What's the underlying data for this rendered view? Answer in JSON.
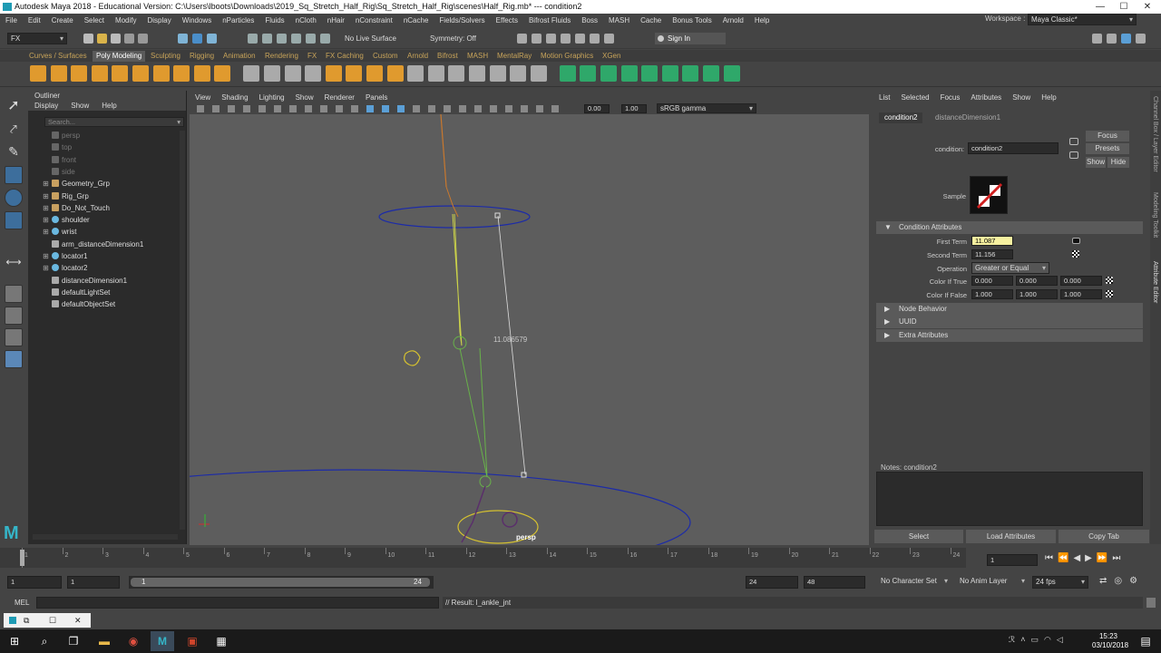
{
  "window": {
    "title": "Autodesk Maya 2018 - Educational Version: C:\\Users\\lboots\\Downloads\\2019_Sq_Stretch_Half_Rig\\Sq_Stretch_Half_Rig\\scenes\\Half_Rig.mb*   ---   condition2",
    "minimize": "—",
    "maximize": "☐",
    "close": "✕"
  },
  "menus": [
    "File",
    "Edit",
    "Create",
    "Select",
    "Modify",
    "Display",
    "Windows",
    "nParticles",
    "Fluids",
    "nCloth",
    "nHair",
    "nConstraint",
    "nCache",
    "Fields/Solvers",
    "Effects",
    "Bifrost Fluids",
    "Boss",
    "MASH",
    "Cache",
    "Bonus Tools",
    "Arnold",
    "Help"
  ],
  "workspace": {
    "label": "Workspace :",
    "value": "Maya Classic*"
  },
  "status": {
    "menuset": "FX",
    "live_surface": "No Live Surface",
    "symmetry": "Symmetry: Off",
    "sign_in": "Sign In"
  },
  "shelf_tabs": [
    "Curves / Surfaces",
    "Poly Modeling",
    "Sculpting",
    "Rigging",
    "Animation",
    "Rendering",
    "FX",
    "FX Caching",
    "Custom",
    "Arnold",
    "Bifrost",
    "MASH",
    "MentalRay",
    "Motion Graphics",
    "XGen"
  ],
  "shelf_active": "Poly Modeling",
  "outliner": {
    "title": "Outliner",
    "menus": [
      "Display",
      "Show",
      "Help"
    ],
    "search_placeholder": "Search...",
    "items": [
      {
        "label": "persp",
        "dim": true,
        "expand": false,
        "icon": "camera-icon"
      },
      {
        "label": "top",
        "dim": true,
        "expand": false,
        "icon": "camera-icon"
      },
      {
        "label": "front",
        "dim": true,
        "expand": false,
        "icon": "camera-icon"
      },
      {
        "label": "side",
        "dim": true,
        "expand": false,
        "icon": "camera-icon"
      },
      {
        "label": "Geometry_Grp",
        "dim": false,
        "expand": true,
        "icon": "group-icon"
      },
      {
        "label": "Rig_Grp",
        "dim": false,
        "expand": true,
        "icon": "group-icon"
      },
      {
        "label": "Do_Not_Touch",
        "dim": false,
        "expand": true,
        "icon": "group-icon"
      },
      {
        "label": "shoulder",
        "dim": false,
        "expand": true,
        "icon": "joint-icon"
      },
      {
        "label": "wrist",
        "dim": false,
        "expand": true,
        "icon": "joint-icon"
      },
      {
        "label": "arm_distanceDimension1",
        "dim": false,
        "expand": false,
        "icon": "dimension-icon"
      },
      {
        "label": "locator1",
        "dim": false,
        "expand": true,
        "icon": "locator-icon"
      },
      {
        "label": "locator2",
        "dim": false,
        "expand": true,
        "icon": "locator-icon"
      },
      {
        "label": "distanceDimension1",
        "dim": false,
        "expand": false,
        "icon": "dimension-icon"
      },
      {
        "label": "defaultLightSet",
        "dim": false,
        "expand": false,
        "icon": "set-icon"
      },
      {
        "label": "defaultObjectSet",
        "dim": false,
        "expand": false,
        "icon": "set-icon"
      }
    ]
  },
  "viewport": {
    "menus": [
      "View",
      "Shading",
      "Lighting",
      "Show",
      "Renderer",
      "Panels"
    ],
    "exposure": "0.00",
    "gamma": "1.00",
    "colorspace": "sRGB gamma",
    "distance_label": "11.086579",
    "camera": "persp"
  },
  "ae": {
    "menus": [
      "List",
      "Selected",
      "Focus",
      "Attributes",
      "Show",
      "Help"
    ],
    "tabs": [
      "condition2",
      "distanceDimension1"
    ],
    "node_label": "condition:",
    "node_value": "condition2",
    "focus": "Focus",
    "presets": "Presets",
    "show": "Show",
    "hide": "Hide",
    "sample": "Sample",
    "section_condition": "Condition Attributes",
    "first_term_label": "First Term",
    "first_term": "11.087",
    "second_term_label": "Second Term",
    "second_term": "11.156",
    "operation_label": "Operation",
    "operation": "Greater or Equal",
    "color_true_label": "Color If True",
    "color_true": [
      "0.000",
      "0.000",
      "0.000"
    ],
    "color_false_label": "Color If False",
    "color_false": [
      "1.000",
      "1.000",
      "1.000"
    ],
    "sections": [
      "Node Behavior",
      "UUID",
      "Extra Attributes"
    ],
    "notes": "Notes:  condition2",
    "btn_select": "Select",
    "btn_load": "Load Attributes",
    "btn_copy": "Copy Tab"
  },
  "side_tabs": [
    "Channel Box / Layer Editor",
    "Modeling Toolkit",
    "Attribute Editor"
  ],
  "timeline": {
    "ticks": [
      "1",
      "2",
      "3",
      "4",
      "5",
      "6",
      "7",
      "8",
      "9",
      "10",
      "11",
      "12",
      "13",
      "14",
      "15",
      "16",
      "17",
      "18",
      "19",
      "20",
      "21",
      "22",
      "23",
      "24"
    ],
    "current": "1"
  },
  "range": {
    "start": "1",
    "anim_start": "1",
    "slider_start": "1",
    "slider_end": "24",
    "end": "24",
    "anim_end": "48",
    "character_set": "No Character Set",
    "anim_layer": "No Anim Layer",
    "fps": "24 fps"
  },
  "cmd": {
    "mel": "MEL",
    "result": "// Result: l_ankle_jnt"
  },
  "taskbar": {
    "time": "15:23",
    "date": "03/10/2018"
  }
}
